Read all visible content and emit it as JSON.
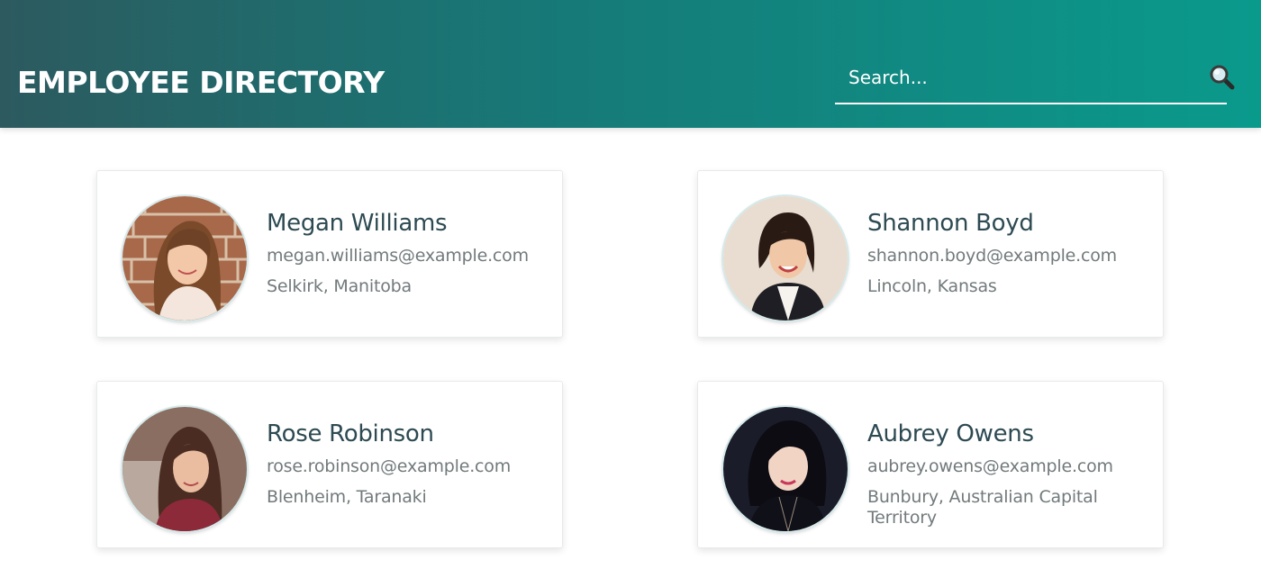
{
  "header": {
    "title": "EMPLOYEE DIRECTORY",
    "search_placeholder": "Search...",
    "search_icon": "magnifying-glass-icon"
  },
  "colors": {
    "header_gradient_start": "#2c5a5f",
    "header_gradient_end": "#0a9a8c",
    "name_text": "#2d4a52",
    "detail_text": "#727a7c"
  },
  "employees": [
    {
      "name": "Megan Williams",
      "email": "megan.williams@example.com",
      "location": "Selkirk, Manitoba"
    },
    {
      "name": "Shannon Boyd",
      "email": "shannon.boyd@example.com",
      "location": "Lincoln, Kansas"
    },
    {
      "name": "Rose Robinson",
      "email": "rose.robinson@example.com",
      "location": "Blenheim, Taranaki"
    },
    {
      "name": "Aubrey Owens",
      "email": "aubrey.owens@example.com",
      "location": "Bunbury, Australian Capital Territory"
    }
  ]
}
